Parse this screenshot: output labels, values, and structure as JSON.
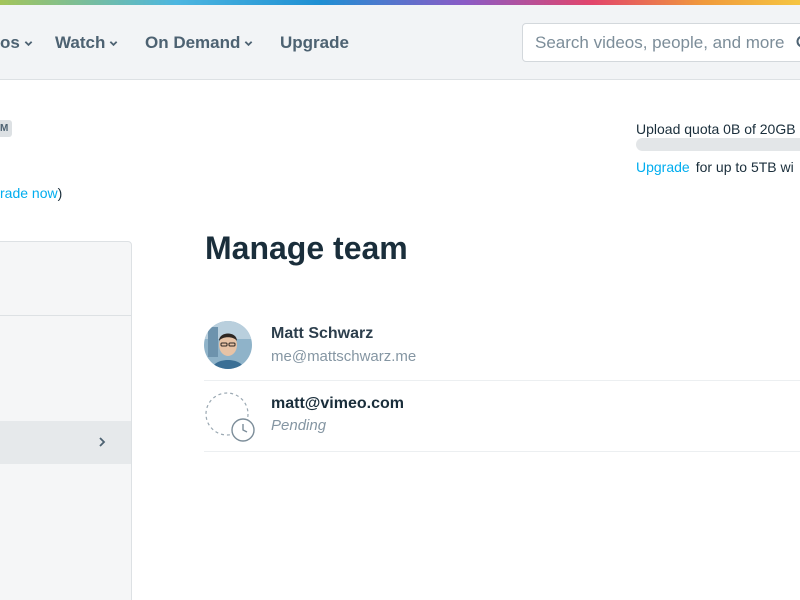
{
  "nav": {
    "items": [
      {
        "label": "os"
      },
      {
        "label": "Watch"
      },
      {
        "label": "On Demand"
      },
      {
        "label": "Upgrade"
      }
    ],
    "search_placeholder": "Search videos, people, and more"
  },
  "account": {
    "badge": "M",
    "upgrade_link": "rade now",
    "upgrade_suffix": ")"
  },
  "quota": {
    "text": "Upload quota 0B of 20GB",
    "used_fraction": 0,
    "upsell_link": "Upgrade",
    "upsell_text": "for up to 5TB wi"
  },
  "main": {
    "title": "Manage team",
    "members": [
      {
        "name": "Matt Schwarz",
        "sub": "me@mattschwarz.me"
      },
      {
        "name": "matt@vimeo.com",
        "sub": "Pending"
      }
    ]
  },
  "colors": {
    "accent": "#00adef",
    "nav_text": "#4d6272",
    "title_text": "#1a2e3b"
  }
}
